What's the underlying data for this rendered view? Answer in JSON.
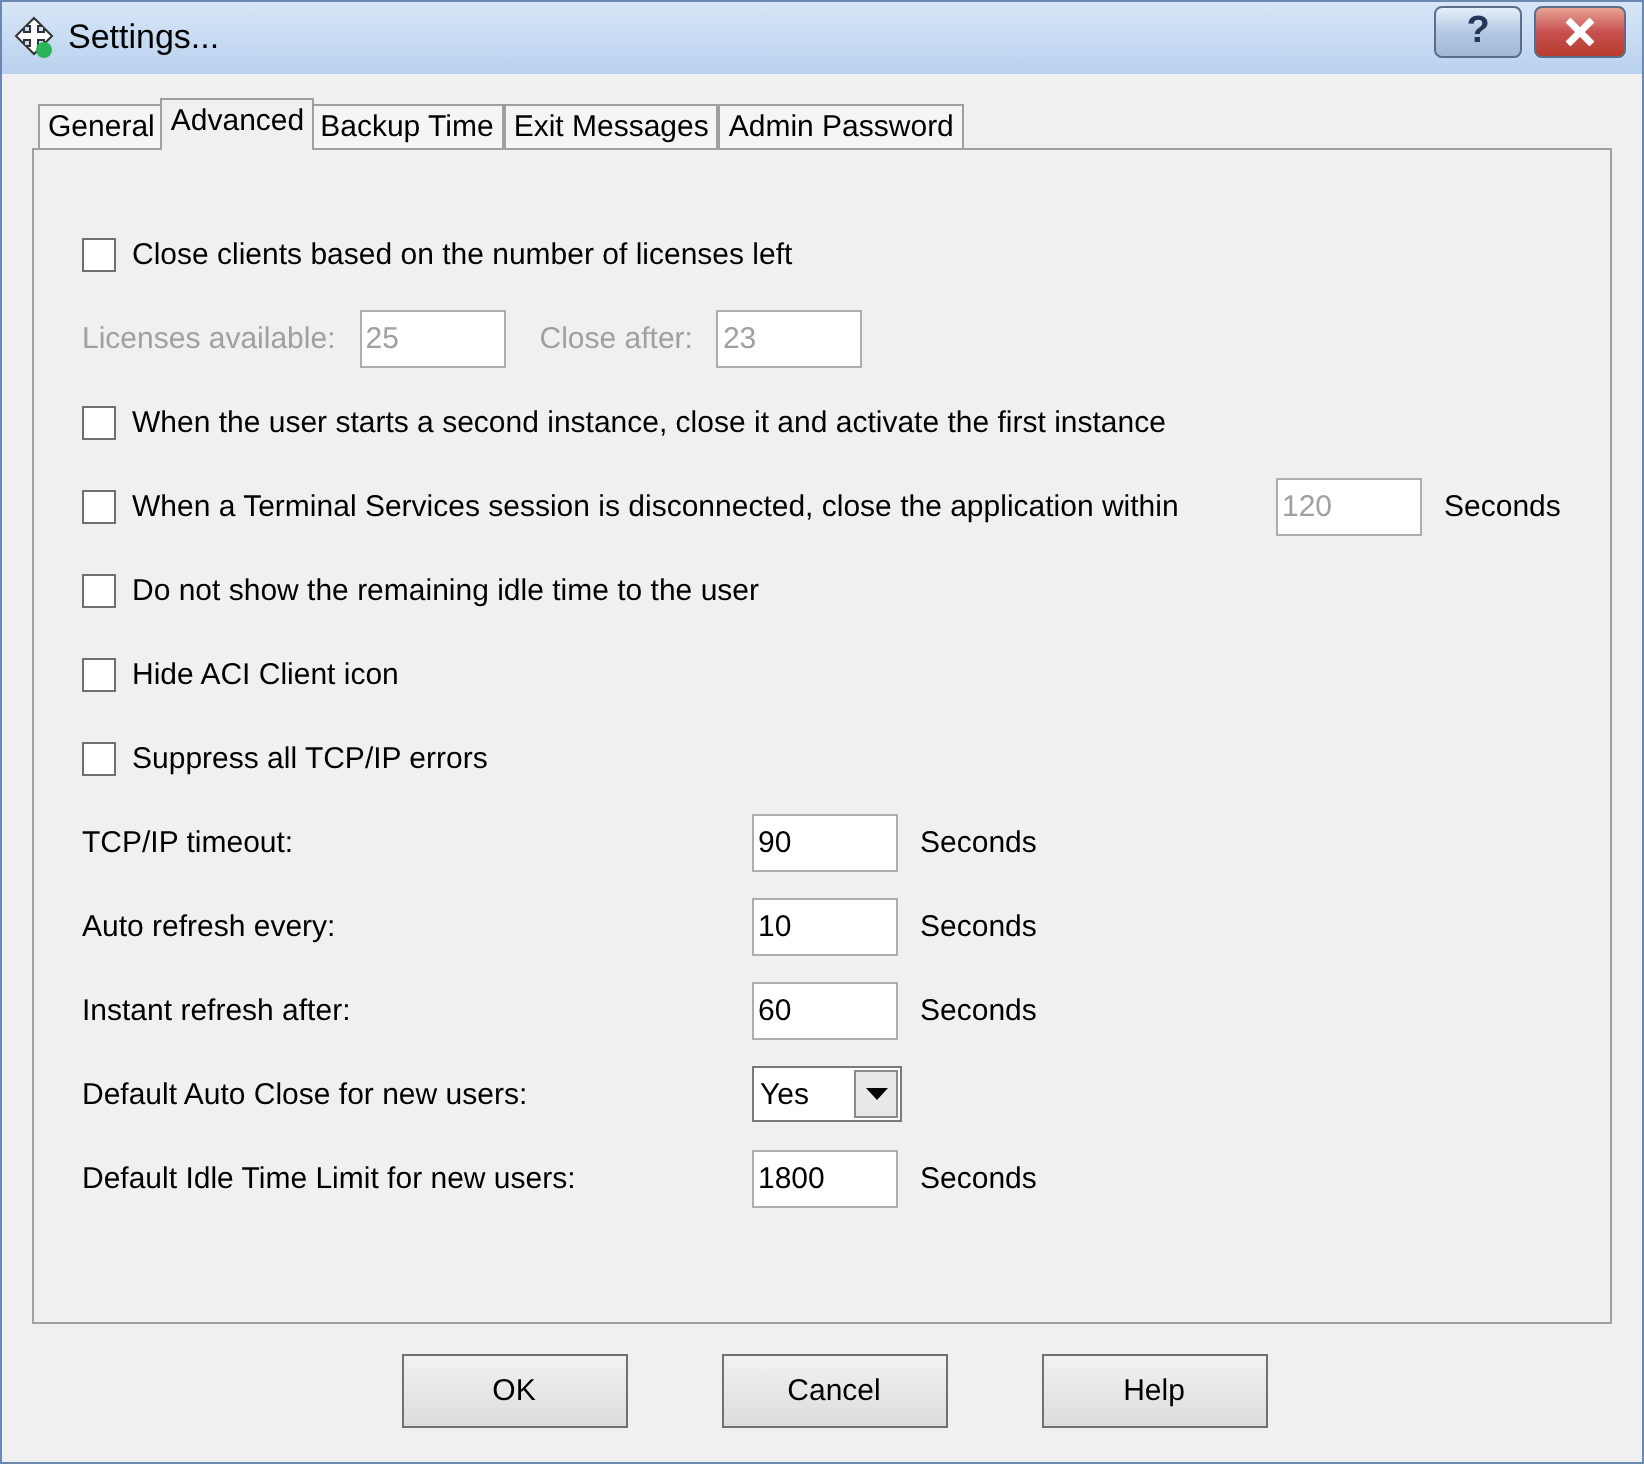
{
  "window": {
    "title": "Settings...",
    "help_button": "?"
  },
  "tabs": [
    {
      "label": "General",
      "selected": false
    },
    {
      "label": "Advanced",
      "selected": true
    },
    {
      "label": "Backup Time",
      "selected": false
    },
    {
      "label": "Exit Messages",
      "selected": false
    },
    {
      "label": "Admin Password",
      "selected": false
    }
  ],
  "items": [
    {
      "kind": "checkbox",
      "label": "Close clients based on the number of licenses left",
      "checked": false
    },
    {
      "kind": "fields",
      "disabled": true,
      "fields": [
        {
          "label": "Licenses available:",
          "value": "25"
        },
        {
          "label": "Close after:",
          "value": "23"
        }
      ]
    },
    {
      "kind": "checkbox",
      "label": "When the user starts a second instance, close it and activate the first instance",
      "checked": false
    },
    {
      "kind": "checkbox",
      "label": "When a Terminal Services session is disconnected, close the application within",
      "checked": false,
      "value": "120",
      "field_disabled": true,
      "unit": "Seconds"
    },
    {
      "kind": "checkbox",
      "label": "Do not show the remaining idle time to the user",
      "checked": false
    },
    {
      "kind": "checkbox",
      "label": "Hide ACI Client icon",
      "checked": false
    },
    {
      "kind": "checkbox",
      "label": "Suppress all TCP/IP errors",
      "checked": false
    },
    {
      "kind": "setting",
      "label": "TCP/IP timeout:",
      "value": "90",
      "unit": "Seconds"
    },
    {
      "kind": "setting",
      "label": "Auto refresh every:",
      "value": "10",
      "unit": "Seconds"
    },
    {
      "kind": "setting",
      "label": "Instant refresh after:",
      "value": "60",
      "unit": "Seconds"
    },
    {
      "kind": "dropdown",
      "label": "Default Auto Close for new users:",
      "value": "Yes"
    },
    {
      "kind": "setting",
      "label": "Default Idle Time Limit for new users:",
      "value": "1800",
      "unit": "Seconds"
    }
  ],
  "buttons": [
    "OK",
    "Cancel",
    "Help"
  ]
}
